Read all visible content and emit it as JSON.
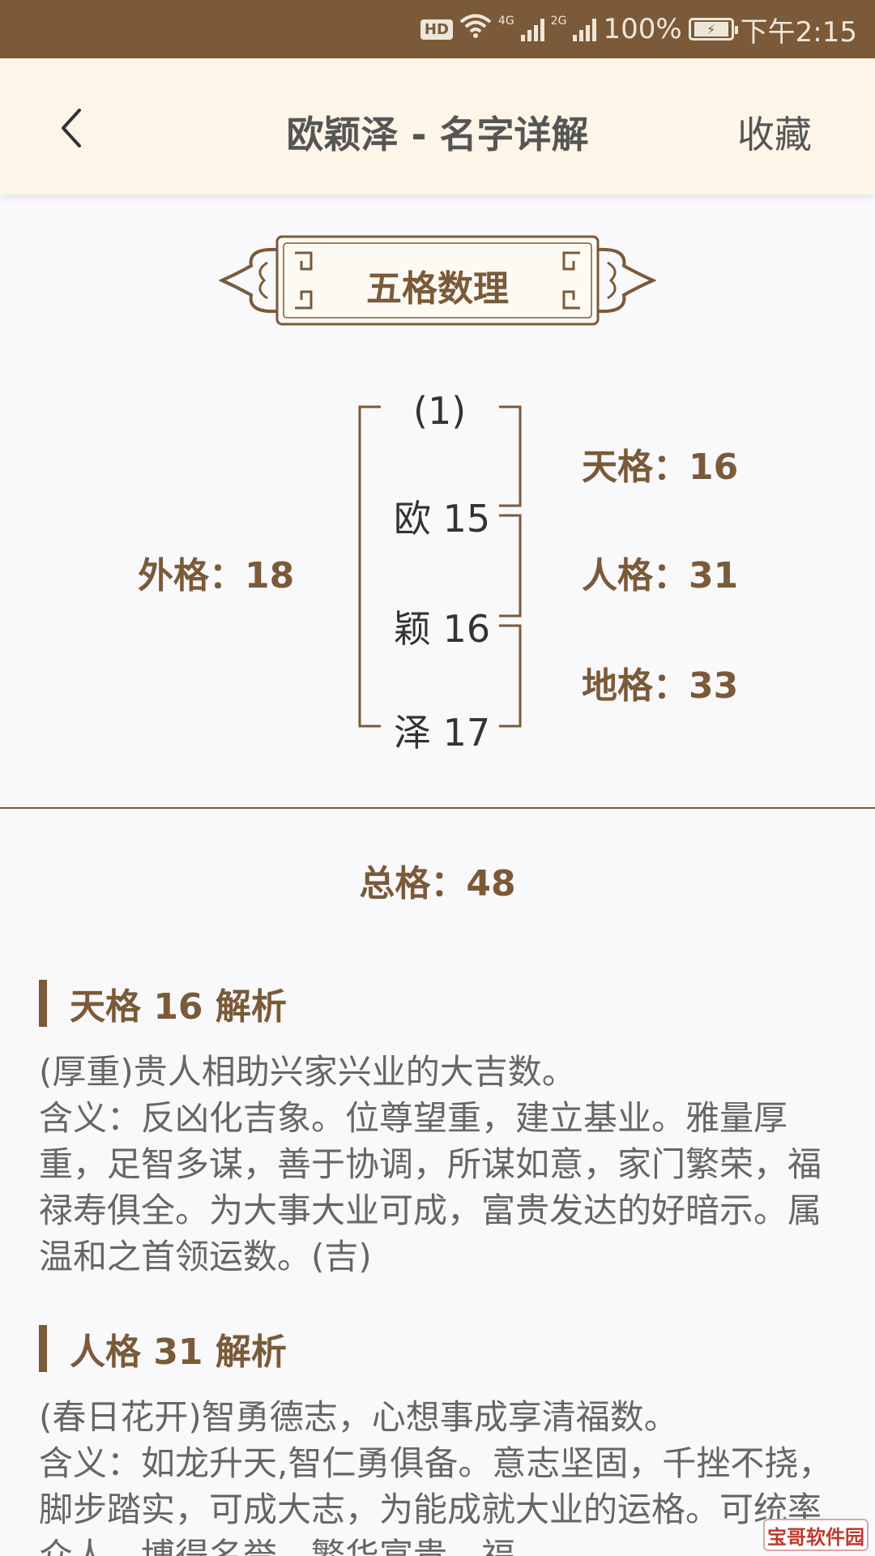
{
  "status_bar": {
    "hd": "HD",
    "net1": "4G",
    "net2": "2G",
    "battery_percent": "100%",
    "time": "下午2:15"
  },
  "header": {
    "title": "欧颖泽 - 名字详解",
    "favorite_label": "收藏"
  },
  "section": {
    "title": "五格数理"
  },
  "diagram": {
    "top_label": "(1)",
    "chars": [
      {
        "char": "欧",
        "strokes": "15",
        "text": "欧 15"
      },
      {
        "char": "颖",
        "strokes": "16",
        "text": "颖 16"
      },
      {
        "char": "泽",
        "strokes": "17",
        "text": "泽 17"
      }
    ],
    "tian_ge": "天格：16",
    "ren_ge": "人格：31",
    "di_ge": "地格：33",
    "wai_ge": "外格：18",
    "zong_ge": "总格：48"
  },
  "analyses": [
    {
      "title": "天格 16 解析",
      "body": "(厚重)贵人相助兴家兴业的大吉数。\n含义：反凶化吉象。位尊望重，建立基业。雅量厚重，足智多谋，善于协调，所谋如意，家门繁荣，福禄寿俱全。为大事大业可成，富贵发达的好暗示。属温和之首领运数。(吉)"
    },
    {
      "title": "人格 31 解析",
      "body": "(春日花开)智勇德志，心想事成享清福数。\n含义：如龙升天,智仁勇俱备。意志坚固，千挫不挠，脚步踏实，可成大志，为能成就大业的运格。可统率众人，博得名誉，繁华富贵。福"
    }
  ],
  "watermark": "宝哥软件园",
  "colors": {
    "brand_brown": "#7a5a38",
    "header_bg": "#fcf5e8",
    "page_bg": "#f9f8fb",
    "body_text": "#666666"
  }
}
